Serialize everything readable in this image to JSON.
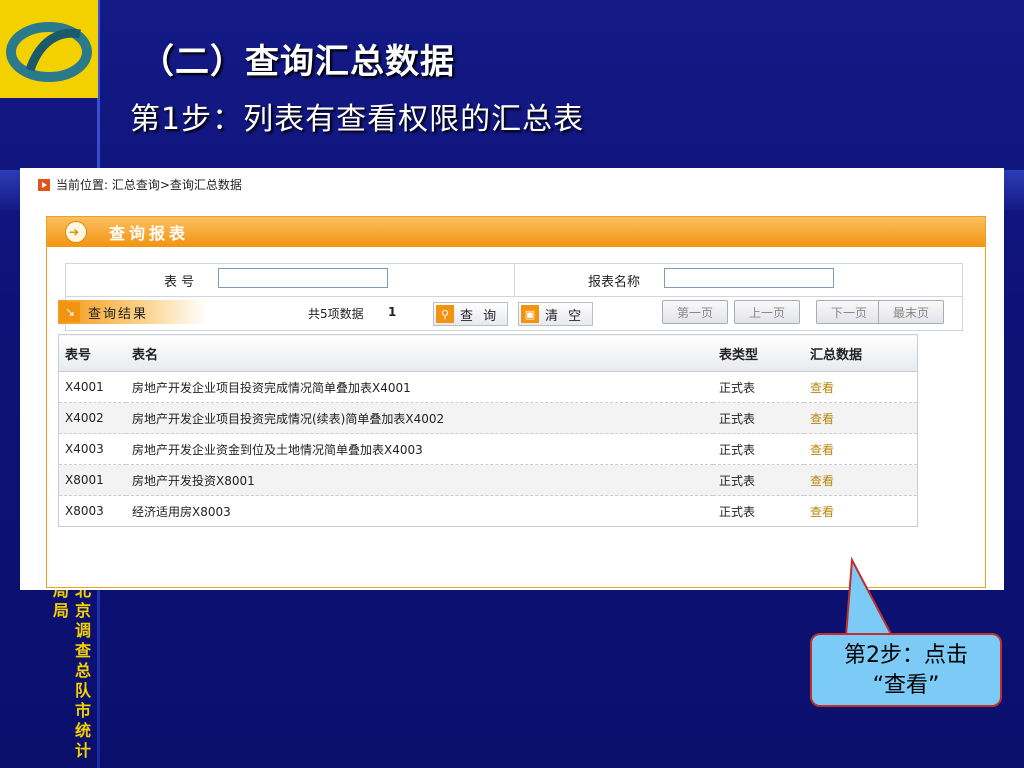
{
  "slide": {
    "title": "（二）查询汇总数据",
    "subtitle": "第1步：列表有查看权限的汇总表",
    "org_text": "北京调查总队市统计局局",
    "callout_line1": "第2步：点击",
    "callout_line2": "“查看”"
  },
  "app": {
    "breadcrumb": "当前位置: 汇总查询>查询汇总数据",
    "panel_title": "查询报表",
    "search": {
      "table_no_label": "表 号",
      "table_no_value": "",
      "table_name_label": "报表名称",
      "table_name_value": "",
      "query_button": "查 询",
      "clear_button": "清 空"
    },
    "results": {
      "tab_label": "查询结果",
      "count_text": "共5项数据",
      "current_page": "1",
      "pager": [
        "第一页",
        "上一页",
        "下一页",
        "最末页"
      ]
    },
    "table": {
      "headers": [
        "表号",
        "表名",
        "表类型",
        "汇总数据"
      ],
      "rows": [
        [
          "X4001",
          "房地产开发企业项目投资完成情况简单叠加表X4001",
          "正式表",
          "查看"
        ],
        [
          "X4002",
          "房地产开发企业项目投资完成情况(续表)简单叠加表X4002",
          "正式表",
          "查看"
        ],
        [
          "X4003",
          "房地产开发企业资金到位及土地情况简单叠加表X4003",
          "正式表",
          "查看"
        ],
        [
          "X8001",
          "房地产开发投资X8001",
          "正式表",
          "查看"
        ],
        [
          "X8003",
          "经济适用房X8003",
          "正式表",
          "查看"
        ]
      ]
    }
  },
  "colors": {
    "slide_bg": "#0d1070",
    "accent_orange": "#f29410",
    "logo_yellow": "#f3d000",
    "callout_blue": "#7ccaf6",
    "callout_border": "#c0302a",
    "link_gold": "#b8860b"
  },
  "icons": [
    "logo-icon",
    "breadcrumb-arrow-icon",
    "panel-arrow-icon",
    "search-icon",
    "trash-icon",
    "result-arrow-icon"
  ]
}
